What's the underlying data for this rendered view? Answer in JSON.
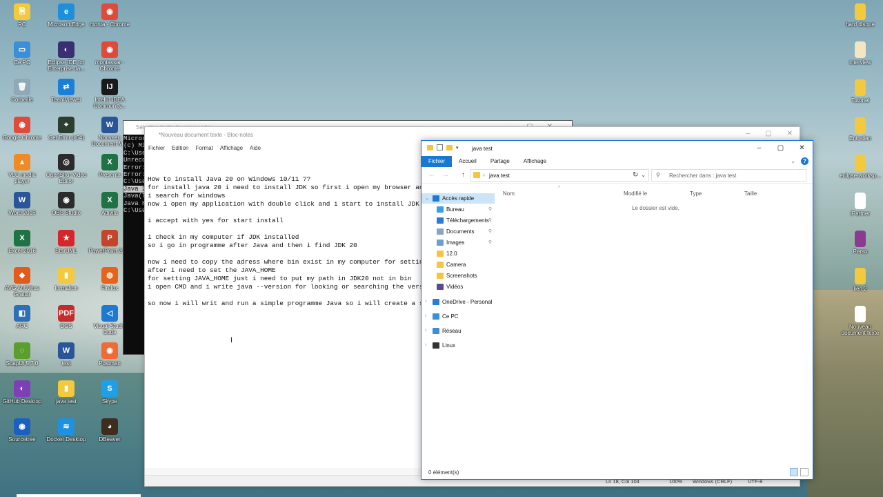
{
  "desktop": {
    "left_icons": [
      {
        "label": "PC",
        "glyph": "🗎",
        "color": "#f3c93e"
      },
      {
        "label": "Microsoft Edge",
        "glyph": "e",
        "color": "#1e8fd8"
      },
      {
        "label": "monta - Chrome",
        "glyph": "◉",
        "color": "#e04a3b"
      },
      {
        "label": "Ce PC",
        "glyph": "▭",
        "color": "#3c8fd6"
      },
      {
        "label": "Eclipse IDE for Enterprise Ja...",
        "glyph": "◐",
        "color": "#3b2f73"
      },
      {
        "label": "montassar - Chrome",
        "glyph": "◉",
        "color": "#e04a3b"
      },
      {
        "label": "Corbeille",
        "glyph": "🗑",
        "color": "#8fa9b8"
      },
      {
        "label": "TeamViewer",
        "glyph": "⇄",
        "color": "#1b7fd6"
      },
      {
        "label": "IntelliJ IDEA Community...",
        "glyph": "IJ",
        "color": "#1a1a1a"
      },
      {
        "label": "Google Chrome",
        "glyph": "◉",
        "color": "#e04a3b"
      },
      {
        "label": "GenEmu (x64)",
        "glyph": "⌖",
        "color": "#2c3e2f"
      },
      {
        "label": "Nouveau Document M...",
        "glyph": "W",
        "color": "#2a5699"
      },
      {
        "label": "VLC media player",
        "glyph": "▲",
        "color": "#f08a24"
      },
      {
        "label": "OpenShot Video Editor",
        "glyph": "◎",
        "color": "#2b2b2b"
      },
      {
        "label": "Presenta",
        "glyph": "X",
        "color": "#1f7244"
      },
      {
        "label": "Word 2016",
        "glyph": "W",
        "color": "#2a5699"
      },
      {
        "label": "OBS Studio",
        "glyph": "◉",
        "color": "#2b2b2b"
      },
      {
        "label": "Attivita",
        "glyph": "X",
        "color": "#1f7244"
      },
      {
        "label": "Excel 2016",
        "glyph": "X",
        "color": "#1f7244"
      },
      {
        "label": "StarUML",
        "glyph": "★",
        "color": "#d7262b"
      },
      {
        "label": "PowerPoint 2016",
        "glyph": "P",
        "color": "#c4452c"
      },
      {
        "label": "AVG AntiVirus Gratuit",
        "glyph": "◆",
        "color": "#e25a1c"
      },
      {
        "label": "formation",
        "glyph": "▮",
        "color": "#f3c93e"
      },
      {
        "label": "Firefox",
        "glyph": "◍",
        "color": "#e8621a"
      },
      {
        "label": "ARC",
        "glyph": "◧",
        "color": "#2f6fb5"
      },
      {
        "label": "DGS",
        "glyph": "PDF",
        "color": "#c62b2b"
      },
      {
        "label": "Visual Studio Code",
        "glyph": "◁",
        "color": "#1e7ad1"
      },
      {
        "label": "SoapUI 5.7.0",
        "glyph": "◌",
        "color": "#5a9e2d"
      },
      {
        "label": "test",
        "glyph": "W",
        "color": "#2a5699"
      },
      {
        "label": "Postman",
        "glyph": "◉",
        "color": "#f06a35"
      },
      {
        "label": "GitHub Desktop",
        "glyph": "◐",
        "color": "#7e3fb6"
      },
      {
        "label": "java test",
        "glyph": "▮",
        "color": "#f3c93e"
      },
      {
        "label": "Skype",
        "glyph": "S",
        "color": "#1ea0e8"
      },
      {
        "label": "Sourcetree",
        "glyph": "◉",
        "color": "#1b5fbf"
      },
      {
        "label": "Docker Desktop",
        "glyph": "≋",
        "color": "#1d92e2"
      },
      {
        "label": "DBeaver",
        "glyph": "◕",
        "color": "#3e2c1e"
      }
    ],
    "right_icons": [
      {
        "label": "hard disque",
        "glyph": "▮",
        "color": "#f3c93e"
      },
      {
        "label": "interview",
        "glyph": "▤",
        "color": "#f3e6c0"
      },
      {
        "label": "Tutoriel",
        "glyph": "▮",
        "color": "#f3c93e"
      },
      {
        "label": "Entretien",
        "glyph": "▮",
        "color": "#f3c93e"
      },
      {
        "label": "eclipse-worksp...",
        "glyph": "▮",
        "color": "#f3c93e"
      },
      {
        "label": "lPartner",
        "glyph": "▭",
        "color": "#ffffff"
      },
      {
        "label": "Perso",
        "glyph": "▮",
        "color": "#8b3b8f"
      },
      {
        "label": "lien 2",
        "glyph": "▮",
        "color": "#f3c93e"
      },
      {
        "label": "Nouveau document texte",
        "glyph": "▭",
        "color": "#ffffff"
      }
    ]
  },
  "cmd": {
    "title": "Sélection Invite de commandes",
    "lines": [
      "Micros",
      "(c) Mi",
      "",
      "C:\\Use",
      "Unreco",
      "Error:",
      "Error:",
      "",
      "C:\\Use",
      "Java 2",
      "Java(T",
      "Java H",
      "",
      "C:\\Use"
    ]
  },
  "notepad": {
    "title": "*Nouveau document texte - Bloc-notes",
    "menu": [
      "Fichier",
      "Edition",
      "Format",
      "Affichage",
      "Aide"
    ],
    "text": "\nHow to install Java 20 on Windows 10/11 ??\nfor install java 20 i need to install JDK so first i open my browser and i\ni search for windows\nnow i open my application with double click and i start to install JDK in m\n\ni accept with yes for start install\n\ni check in my computer if JDK installed\nso i go in programme after Java and then i find JDK 20\n\nnow i need to copy the adress where bin exist in my computer for setting Va\nafter i need to set the JAVA_HOME\nfor setting JAVA_HOME just i need to put my path in JDK20 not in bin\ni open CMD and i write java --version for looking or searching the version\n\nso now i will writ and run a simple programme Java so i will create a simpl",
    "status": {
      "position": "Ln 18, Col 104",
      "zoom": "100%",
      "eol": "Windows (CRLF)",
      "encoding": "UTF-8"
    }
  },
  "explorer": {
    "title": "java test",
    "tabs": [
      "Fichier",
      "Accueil",
      "Partage",
      "Affichage"
    ],
    "address": "java test",
    "search_placeholder": "Rechercher dans : java test",
    "columns": [
      "Nom",
      "Modifié le",
      "Type",
      "Taille"
    ],
    "empty_message": "Le dossier est vide.",
    "status": "0 élément(s)",
    "nav": [
      {
        "label": "Accès rapide",
        "icon": "star-icon",
        "color": "#1e78d4",
        "level": 0,
        "selected": true,
        "expand": "⌄",
        "pinned": false
      },
      {
        "label": "Bureau",
        "icon": "desktop-icon",
        "color": "#3a9ee4",
        "level": 1,
        "selected": false,
        "expand": "",
        "pinned": true
      },
      {
        "label": "Téléchargements",
        "icon": "download-icon",
        "color": "#2b7bd0",
        "level": 1,
        "selected": false,
        "expand": "",
        "pinned": true
      },
      {
        "label": "Documents",
        "icon": "documents-icon",
        "color": "#8aa4bd",
        "level": 1,
        "selected": false,
        "expand": "",
        "pinned": true
      },
      {
        "label": "Images",
        "icon": "images-icon",
        "color": "#6a9fd1",
        "level": 1,
        "selected": false,
        "expand": "",
        "pinned": true
      },
      {
        "label": "12.0",
        "icon": "folder-icon",
        "color": "#f5c542",
        "level": 1,
        "selected": false,
        "expand": "",
        "pinned": false
      },
      {
        "label": "Camera",
        "icon": "folder-icon",
        "color": "#f5c542",
        "level": 1,
        "selected": false,
        "expand": "",
        "pinned": false
      },
      {
        "label": "Screenshots",
        "icon": "folder-icon",
        "color": "#f5c542",
        "level": 1,
        "selected": false,
        "expand": "",
        "pinned": false
      },
      {
        "label": "Vidéos",
        "icon": "videos-icon",
        "color": "#5b4a8f",
        "level": 1,
        "selected": false,
        "expand": "",
        "pinned": false
      },
      {
        "label": "OneDrive - Personal",
        "icon": "cloud-icon",
        "color": "#2a7fd2",
        "level": 0,
        "selected": false,
        "expand": "›",
        "pinned": false
      },
      {
        "label": "Ce PC",
        "icon": "computer-icon",
        "color": "#3c8fd6",
        "level": 0,
        "selected": false,
        "expand": "›",
        "pinned": false
      },
      {
        "label": "Réseau",
        "icon": "network-icon",
        "color": "#3c8fd6",
        "level": 0,
        "selected": false,
        "expand": "›",
        "pinned": false
      },
      {
        "label": "Linux",
        "icon": "penguin-icon",
        "color": "#333333",
        "level": 0,
        "selected": false,
        "expand": "›",
        "pinned": false
      }
    ]
  }
}
